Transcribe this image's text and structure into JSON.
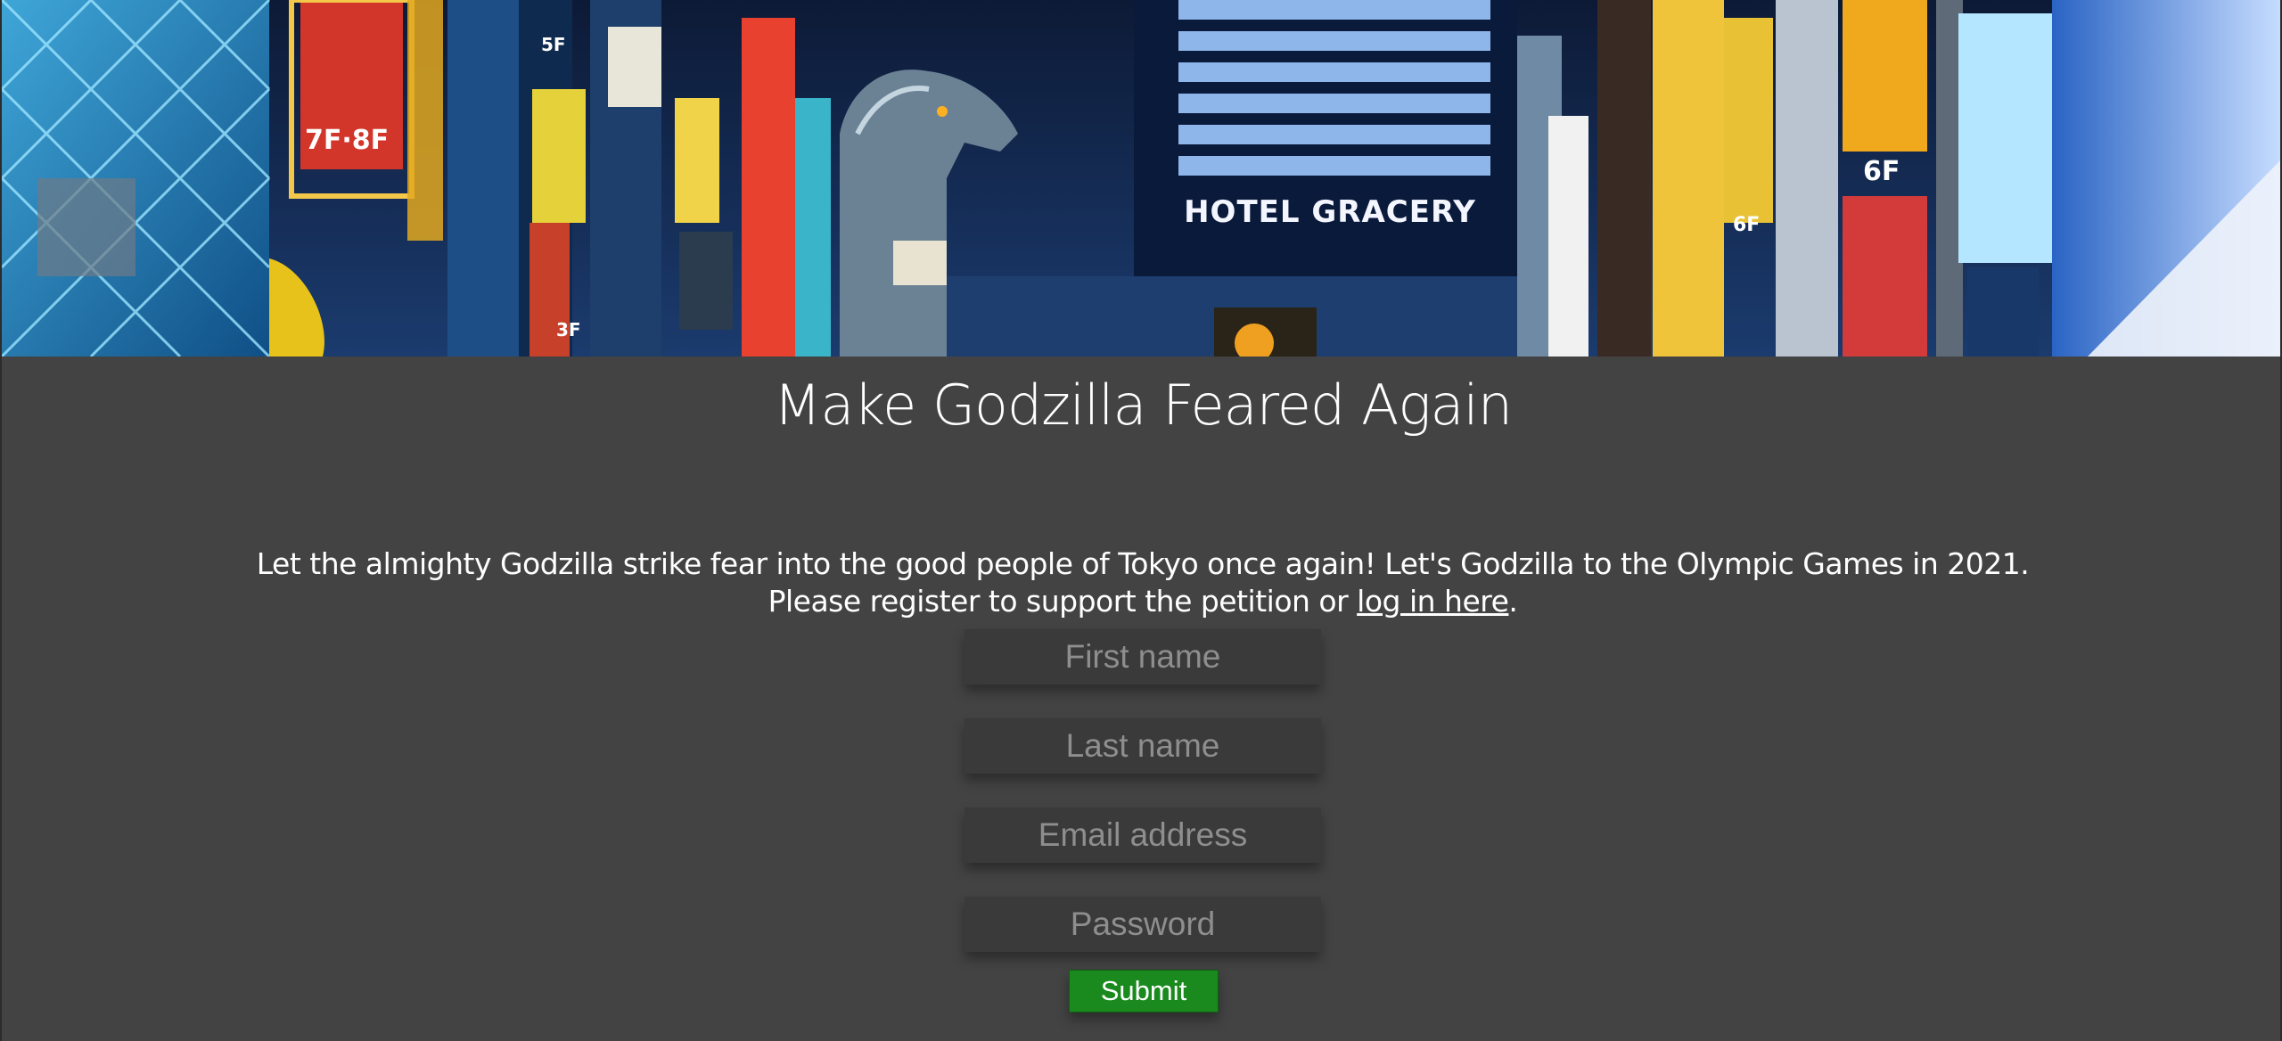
{
  "banner": {
    "alt": "Tokyo street with Godzilla statue atop Hotel Gracery",
    "hotel_sign": "HOTEL GRACERY",
    "sign_7f": "7F·8F",
    "sign_6f": "6F",
    "sign_6f_b": "6F",
    "sign_5f": "5F",
    "sign_3f": "3F"
  },
  "main": {
    "title": "Make Godzilla Feared Again",
    "intro_line1": "Let the almighty Godzilla strike fear into the good people of Tokyo once again! Let's Godzilla to the Olympic Games in 2021.",
    "intro_line2_prefix": "Please register to support the petition or ",
    "login_link": "log in here",
    "intro_line2_suffix": "."
  },
  "form": {
    "first_name_placeholder": "First name",
    "last_name_placeholder": "Last name",
    "email_placeholder": "Email address",
    "password_placeholder": "Password",
    "submit_label": "Submit"
  },
  "colors": {
    "background": "#434343",
    "field_background": "#3a3a3a",
    "submit": "#1a8a1e"
  }
}
